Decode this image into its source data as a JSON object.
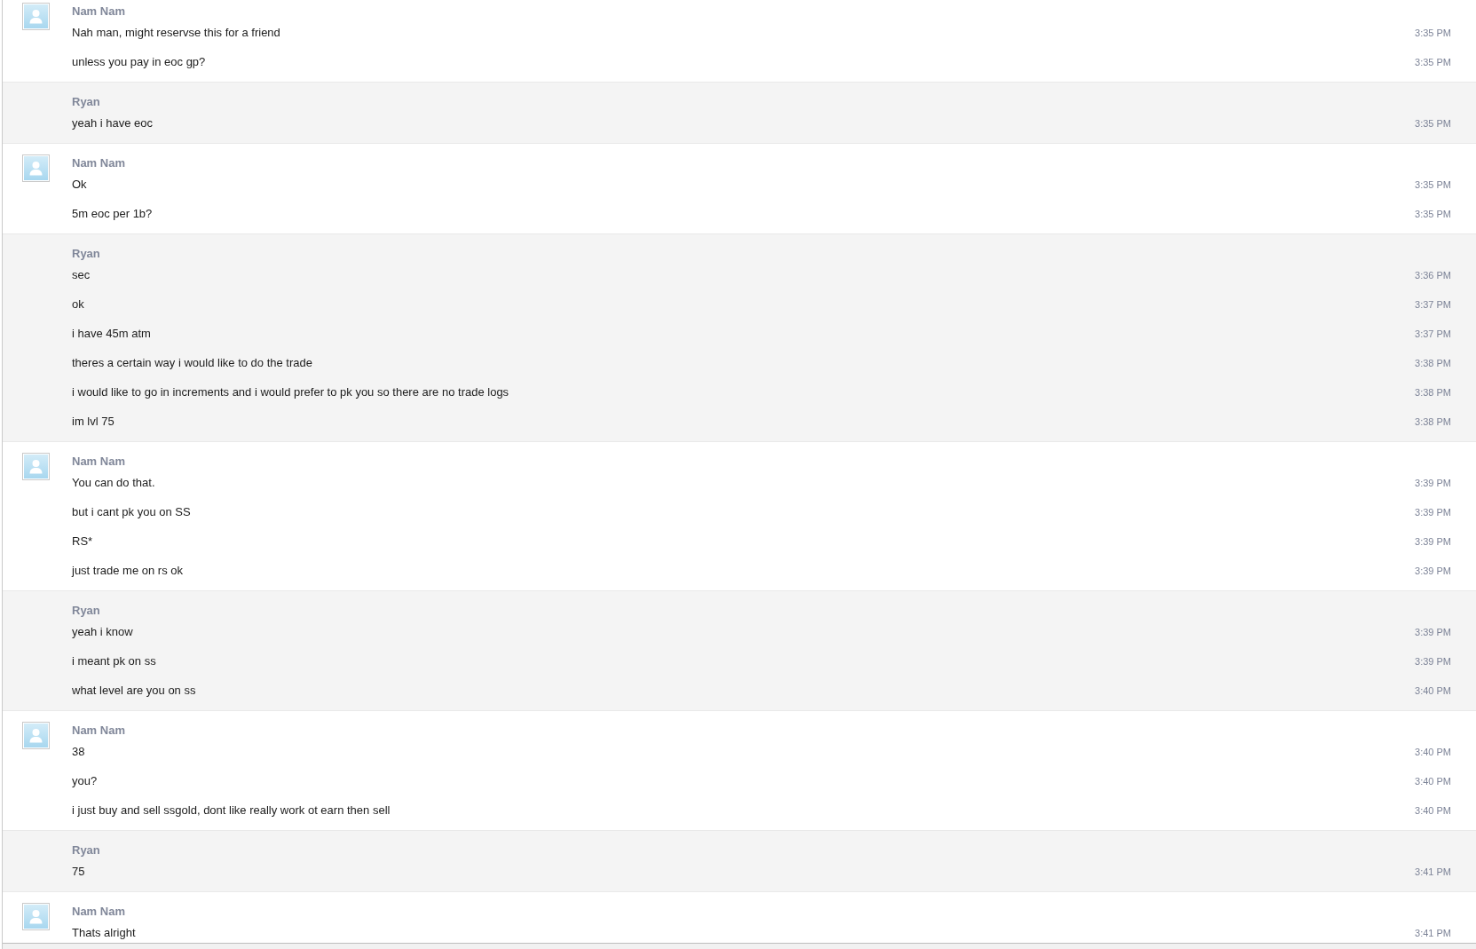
{
  "conversation": {
    "groups": [
      {
        "kind": "avatar",
        "sender": "Nam Nam",
        "messages": [
          {
            "text": "Nah man, might reservse this for a friend",
            "time": "3:35 PM"
          },
          {
            "text": "unless you pay in eoc gp?",
            "time": "3:35 PM"
          }
        ]
      },
      {
        "kind": "shaded",
        "sender": "Ryan",
        "messages": [
          {
            "text": "yeah i have eoc",
            "time": "3:35 PM"
          }
        ]
      },
      {
        "kind": "avatar",
        "sender": "Nam Nam",
        "messages": [
          {
            "text": "Ok",
            "time": "3:35 PM"
          },
          {
            "text": "5m eoc per 1b?",
            "time": "3:35 PM"
          }
        ]
      },
      {
        "kind": "shaded",
        "sender": "Ryan",
        "messages": [
          {
            "text": "sec",
            "time": "3:36 PM"
          },
          {
            "text": "ok",
            "time": "3:37 PM"
          },
          {
            "text": "i have 45m atm",
            "time": "3:37 PM"
          },
          {
            "text": "theres a certain way i would like to do the trade",
            "time": "3:38 PM"
          },
          {
            "text": "i would like to go in increments and i would prefer to pk you so there are no trade logs",
            "time": "3:38 PM"
          },
          {
            "text": "im lvl 75",
            "time": "3:38 PM"
          }
        ]
      },
      {
        "kind": "avatar",
        "sender": "Nam Nam",
        "messages": [
          {
            "text": "You can do that.",
            "time": "3:39 PM"
          },
          {
            "text": "but i cant pk you on SS",
            "time": "3:39 PM"
          },
          {
            "text": "RS*",
            "time": "3:39 PM"
          },
          {
            "text": "just trade me on rs ok",
            "time": "3:39 PM"
          }
        ]
      },
      {
        "kind": "shaded",
        "sender": "Ryan",
        "messages": [
          {
            "text": "yeah i know",
            "time": "3:39 PM"
          },
          {
            "text": "i meant pk on ss",
            "time": "3:39 PM"
          },
          {
            "text": "what level are you on ss",
            "time": "3:40 PM"
          }
        ]
      },
      {
        "kind": "avatar",
        "sender": "Nam Nam",
        "messages": [
          {
            "text": "38",
            "time": "3:40 PM"
          },
          {
            "text": "you?",
            "time": "3:40 PM"
          },
          {
            "text": "i just buy and sell ssgold, dont like really work ot earn then sell",
            "time": "3:40 PM"
          }
        ]
      },
      {
        "kind": "shaded",
        "sender": "Ryan",
        "messages": [
          {
            "text": "75",
            "time": "3:41 PM"
          }
        ]
      },
      {
        "kind": "avatar",
        "sender": "Nam Nam",
        "messages": [
          {
            "text": "Thats alright",
            "time": "3:41 PM"
          }
        ]
      }
    ]
  }
}
